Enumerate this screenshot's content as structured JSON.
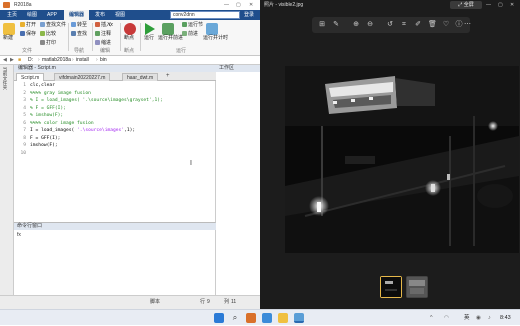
{
  "matlab": {
    "window_title": "R2018a",
    "tabs": [
      "主页",
      "绘图",
      "APP",
      "编辑器",
      "发布",
      "视图"
    ],
    "active_tab_index": 3,
    "search_value": "conv2dnn",
    "login_label": "登录",
    "ribbon": {
      "new_label": "新建",
      "open_label": "打开",
      "save_label": "保存",
      "find_files": "查找文件",
      "compare": "比较",
      "print": "打印",
      "goto": "转至",
      "find": "查找",
      "insert": "插入",
      "comment": "注释",
      "indent": "缩进",
      "fx": "fx",
      "breakpoint": "断点",
      "run": "运行",
      "run_section": "运行节",
      "run_and_advance": "运行并前进",
      "run_and_time": "运行并计时",
      "advance": "前进",
      "section_file": "文件",
      "section_navigate": "导航",
      "section_edit": "编辑",
      "section_breakpoint": "断点",
      "section_run": "运行"
    },
    "path": [
      "D:",
      "matlab2018a",
      "install",
      "bin"
    ],
    "left_panel_label": "当前文件夹",
    "editor_header": "编辑器 - Script.m",
    "editor_tabs": [
      "Script.m",
      "vifdmain20220227.m",
      "haar_dwt.m"
    ],
    "code_lines": [
      {
        "num": "1",
        "segments": [
          {
            "t": "clc,clear",
            "c": "plain"
          }
        ]
      },
      {
        "num": "2",
        "segments": [
          {
            "t": "%%%% gray image fusion",
            "c": "comment"
          }
        ]
      },
      {
        "num": "3",
        "segments": [
          {
            "t": "% I = load_images( '.\\source\\images\\grayset',1);",
            "c": "comment"
          }
        ]
      },
      {
        "num": "4",
        "segments": [
          {
            "t": "% F = GFF(I);",
            "c": "comment"
          }
        ]
      },
      {
        "num": "5",
        "segments": [
          {
            "t": "% imshow(F);",
            "c": "comment"
          }
        ]
      },
      {
        "num": "6",
        "segments": [
          {
            "t": "%%%% color image fusion",
            "c": "comment"
          }
        ]
      },
      {
        "num": "7",
        "segments": [
          {
            "t": "I = load_images( ",
            "c": "plain"
          },
          {
            "t": "'.\\source\\images'",
            "c": "string"
          },
          {
            "t": ",1);",
            "c": "plain"
          }
        ]
      },
      {
        "num": "8",
        "segments": [
          {
            "t": "F = GFF(I);",
            "c": "plain"
          }
        ]
      },
      {
        "num": "9",
        "segments": [
          {
            "t": "imshow(F);",
            "c": "plain"
          }
        ]
      },
      {
        "num": "10",
        "segments": [
          {
            "t": "",
            "c": "plain"
          }
        ]
      }
    ],
    "command_window_label": "命令行窗口",
    "workspace_label": "工作区",
    "status": {
      "mode": "脚本",
      "row_label": "行",
      "row": "9",
      "col_label": "列",
      "col": "11"
    }
  },
  "photos": {
    "title": "照片 - visible2.jpg",
    "fullscreen_label": "全屏",
    "toolbar_icons": [
      "add-to-icon",
      "edit-icon",
      "zoom-in-icon",
      "zoom-out-icon",
      "rotate-icon",
      "crop-icon",
      "draw-icon",
      "delete-icon",
      "favorite-icon",
      "info-icon",
      "more-icon"
    ],
    "thumbnails": [
      "visible-thumb",
      "infrared-thumb"
    ]
  },
  "taskbar": {
    "apps": [
      "windows-start-icon",
      "search-icon",
      "matlab-icon",
      "photos-icon",
      "file-explorer-icon",
      "pictures-icon"
    ],
    "tray": {
      "ime": "英",
      "time": "8:43"
    }
  },
  "colors": {
    "matlab_blue": "#1f4e8c",
    "comment": "#228b22",
    "string": "#a020f0",
    "photos_bg": "#1c1c1c"
  }
}
